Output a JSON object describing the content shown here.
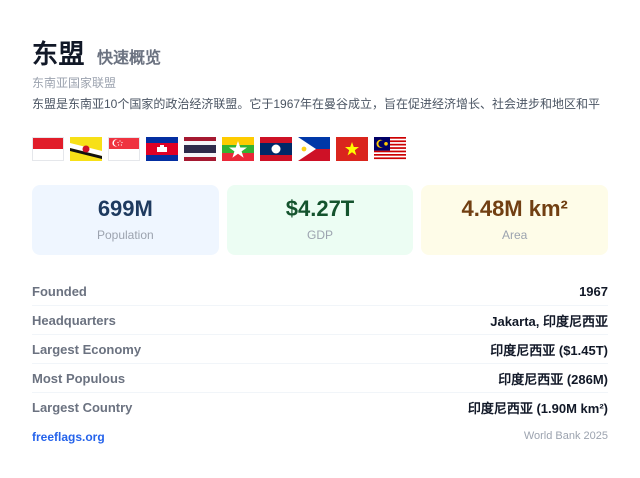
{
  "header": {
    "title": "东盟",
    "subtitle": "快速概览",
    "region": "东南亚国家联盟",
    "description": "东盟是东南亚10个国家的政治经济联盟。它于1967年在曼谷成立，旨在促进经济增长、社会进步和地区和平"
  },
  "flags": [
    {
      "name": "indonesia-flag"
    },
    {
      "name": "brunei-flag"
    },
    {
      "name": "singapore-flag"
    },
    {
      "name": "cambodia-flag"
    },
    {
      "name": "thailand-flag"
    },
    {
      "name": "myanmar-flag"
    },
    {
      "name": "laos-flag"
    },
    {
      "name": "philippines-flag"
    },
    {
      "name": "vietnam-flag"
    },
    {
      "name": "malaysia-flag"
    }
  ],
  "stats": [
    {
      "value": "699M",
      "label": "Population"
    },
    {
      "value": "$4.27T",
      "label": "GDP"
    },
    {
      "value": "4.48M km²",
      "label": "Area"
    }
  ],
  "facts": [
    {
      "key": "Founded",
      "value": "1967"
    },
    {
      "key": "Headquarters",
      "value": "Jakarta, 印度尼西亚"
    },
    {
      "key": "Largest Economy",
      "value": "印度尼西亚 ($1.45T)"
    },
    {
      "key": "Most Populous",
      "value": "印度尼西亚 (286M)"
    },
    {
      "key": "Largest Country",
      "value": "印度尼西亚 (1.90M km²)"
    }
  ],
  "footer": {
    "link": "freeflags.org",
    "source": "World Bank 2025"
  },
  "colors": {
    "link": "#2563eb",
    "population_bg": "#eff6ff",
    "gdp_bg": "#ecfdf3",
    "area_bg": "#fefce8"
  }
}
